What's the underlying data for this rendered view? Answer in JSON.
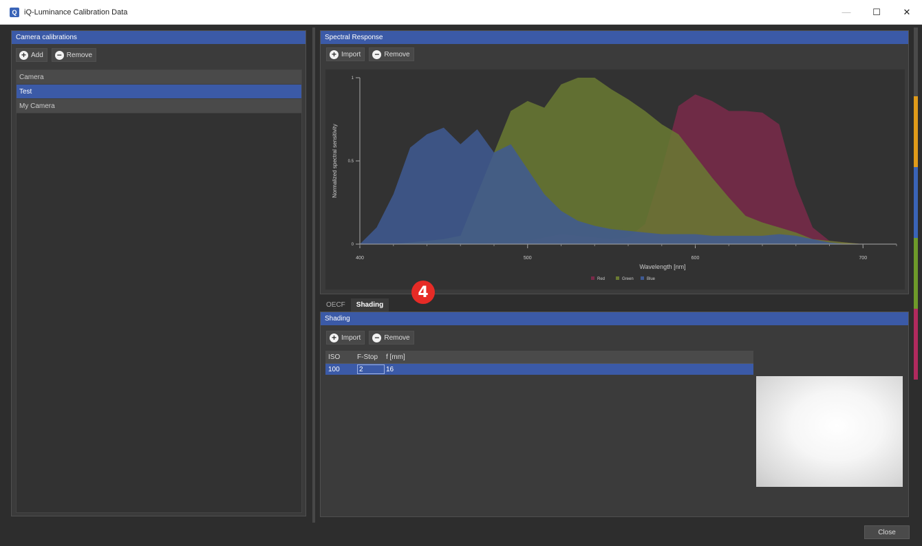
{
  "window": {
    "title": "iQ-Luminance Calibration Data",
    "icon_label": "Q",
    "minimize_glyph": "—",
    "maximize_glyph": "☐",
    "close_glyph": "✕"
  },
  "camera_panel": {
    "header": "Camera calibrations",
    "add_label": "Add",
    "remove_label": "Remove",
    "items": [
      {
        "label": "Camera",
        "selected": false
      },
      {
        "label": "Test",
        "selected": true
      },
      {
        "label": "My Camera",
        "selected": false
      }
    ]
  },
  "spectral_panel": {
    "header": "Spectral Response",
    "import_label": "Import",
    "remove_label": "Remove"
  },
  "chart_data": {
    "type": "area",
    "xlabel": "Wavelength [nm]",
    "ylabel": "Normalized spectral sensitivity",
    "xlim": [
      400,
      720
    ],
    "ylim": [
      0,
      1
    ],
    "x_ticks": [
      "400",
      "500",
      "600",
      "700"
    ],
    "y_ticks": [
      "0",
      "0.5",
      "1"
    ],
    "legend_position": "bottom-center",
    "x": [
      400,
      410,
      420,
      430,
      440,
      450,
      460,
      470,
      480,
      490,
      500,
      510,
      520,
      530,
      540,
      550,
      560,
      570,
      580,
      590,
      600,
      610,
      620,
      630,
      640,
      650,
      660,
      670,
      680,
      690,
      700,
      710,
      720
    ],
    "series": [
      {
        "name": "Red",
        "color": "#7a2a4a",
        "values": [
          0,
          0,
          0,
          0,
          0,
          0,
          0,
          0,
          0.01,
          0.01,
          0.02,
          0.04,
          0.06,
          0.05,
          0.04,
          0.03,
          0.04,
          0.12,
          0.45,
          0.83,
          0.9,
          0.86,
          0.8,
          0.8,
          0.79,
          0.72,
          0.35,
          0.1,
          0.02,
          0.01,
          0,
          0,
          0
        ]
      },
      {
        "name": "Green",
        "color": "#6a7a32",
        "values": [
          0,
          0,
          0,
          0.01,
          0.02,
          0.03,
          0.05,
          0.3,
          0.55,
          0.8,
          0.86,
          0.82,
          0.96,
          1.0,
          1.0,
          0.93,
          0.87,
          0.8,
          0.72,
          0.66,
          0.53,
          0.4,
          0.28,
          0.17,
          0.13,
          0.1,
          0.07,
          0.03,
          0.02,
          0.01,
          0,
          0,
          0
        ]
      },
      {
        "name": "Blue",
        "color": "#3f5a93",
        "values": [
          0,
          0.1,
          0.3,
          0.58,
          0.66,
          0.7,
          0.6,
          0.69,
          0.55,
          0.6,
          0.45,
          0.3,
          0.2,
          0.14,
          0.11,
          0.09,
          0.08,
          0.07,
          0.06,
          0.06,
          0.06,
          0.05,
          0.05,
          0.05,
          0.05,
          0.06,
          0.05,
          0.03,
          0.01,
          0,
          0,
          0,
          0
        ]
      }
    ]
  },
  "tabs": [
    {
      "label": "OECF",
      "active": false
    },
    {
      "label": "Shading",
      "active": true
    }
  ],
  "marker_label": "4",
  "shading_panel": {
    "header": "Shading",
    "import_label": "Import",
    "remove_label": "Remove",
    "columns": [
      "ISO",
      "F-Stop",
      "f [mm]"
    ],
    "rows": [
      {
        "iso": "100",
        "fstop": "2",
        "f": "16"
      }
    ]
  },
  "footer": {
    "close_label": "Close"
  }
}
